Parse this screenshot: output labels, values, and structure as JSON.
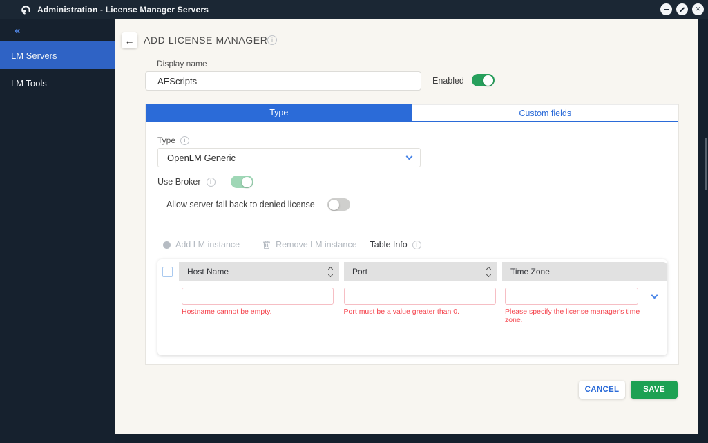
{
  "window": {
    "title": "Administration - License Manager Servers"
  },
  "sidebar": {
    "collapse_glyph": "«",
    "items": [
      {
        "label": "LM Servers",
        "active": true
      },
      {
        "label": "LM Tools",
        "active": false
      }
    ]
  },
  "page": {
    "title": "ADD LICENSE MANAGER"
  },
  "form": {
    "display_name": {
      "label": "Display name",
      "value": "AEScripts"
    },
    "enabled": {
      "label": "Enabled",
      "state": "on"
    },
    "type_field": {
      "label": "Type",
      "value": "OpenLM Generic"
    },
    "use_broker": {
      "label": "Use Broker",
      "state": "on"
    },
    "fallback": {
      "label": "Allow server fall back to denied license",
      "state": "off"
    }
  },
  "tabs": [
    {
      "label": "Type",
      "active": true
    },
    {
      "label": "Custom fields",
      "active": false
    }
  ],
  "toolbar": {
    "add_label": "Add LM instance",
    "remove_label": "Remove LM instance",
    "table_info_label": "Table Info"
  },
  "table": {
    "columns": [
      {
        "label": "Host Name",
        "sortable": true
      },
      {
        "label": "Port",
        "sortable": true
      },
      {
        "label": "Time Zone",
        "sortable": false
      }
    ],
    "row_values": {
      "host_name": "",
      "port": "",
      "time_zone": ""
    },
    "errors": [
      "Hostname cannot be empty.",
      "Port must be a value greater than 0.",
      "Please specify the license manager's time zone."
    ]
  },
  "footer": {
    "cancel_label": "CANCEL",
    "save_label": "SAVE"
  },
  "icons": {
    "app_logo": "openlm-swirl",
    "window": [
      "minimize-icon",
      "block-icon",
      "close-icon"
    ],
    "back": "arrow-left-icon",
    "info": "i",
    "dropdown": "chevron-down-icon",
    "sort": "sort-carets-icon",
    "add": "circle-icon",
    "remove": "trash-icon",
    "back_glyph": "←"
  },
  "colors": {
    "accent_blue": "#2b6bd8",
    "sidebar_active": "#2f63c5",
    "green": "#1da153",
    "pale_green": "#9fd7b6",
    "error_red": "#f5464f",
    "dark_frame": "#16212e",
    "cream_bg": "#f8f6f1"
  }
}
